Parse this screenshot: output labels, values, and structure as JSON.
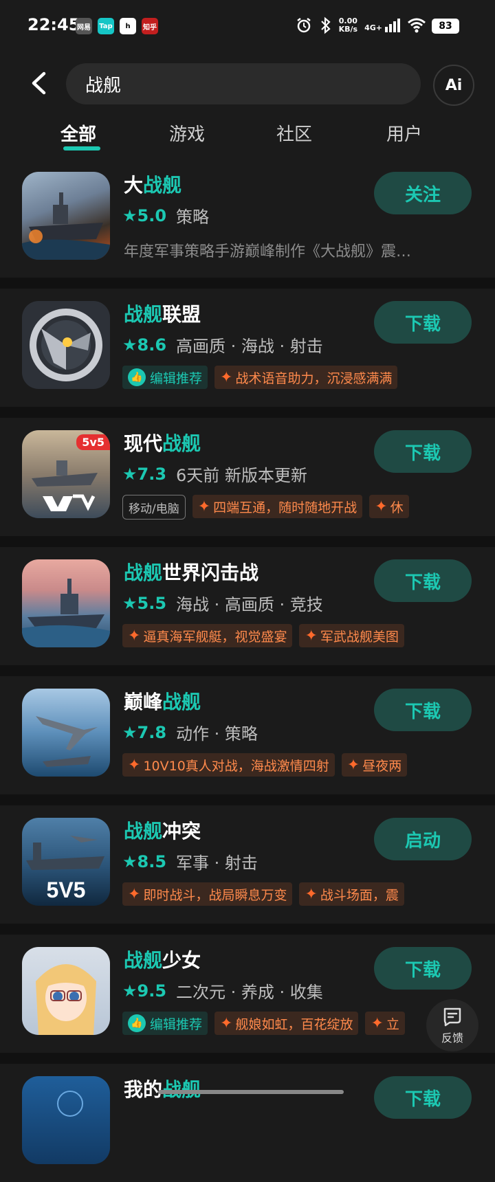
{
  "status": {
    "time": "22:45",
    "app_icons": [
      "网易",
      "Tap",
      "h",
      "知乎"
    ],
    "net_speed_value": "0.00",
    "net_speed_unit": "KB/s",
    "network": "4G+",
    "battery": "83"
  },
  "search": {
    "query": "战舰",
    "ai_label": "Ai"
  },
  "tabs": [
    {
      "label": "全部",
      "active": true
    },
    {
      "label": "游戏",
      "active": false
    },
    {
      "label": "社区",
      "active": false
    },
    {
      "label": "用户",
      "active": false
    }
  ],
  "results": [
    {
      "title_prefix": "大",
      "title_hl": "战舰",
      "title_suffix": "",
      "rating": "★5.0",
      "meta": "策略",
      "desc": "年度军事策略手游巅峰制作《大战舰》震…",
      "action": "关注",
      "tags": []
    },
    {
      "title_prefix": "",
      "title_hl": "战舰",
      "title_suffix": "联盟",
      "rating": "★8.6",
      "meta": "高画质 · 海战 · 射击",
      "desc": "",
      "action": "下载",
      "tags": [
        "编辑推荐",
        "战术语音助力，沉浸感满满"
      ]
    },
    {
      "title_prefix": "现代",
      "title_hl": "战舰",
      "title_suffix": "",
      "rating": "★7.3",
      "meta": "6天前 新版本更新",
      "desc": "",
      "action": "下载",
      "badge": "5v5",
      "platform": "移动/电脑",
      "tags": [
        "四端互通，随时随地开战",
        "休"
      ]
    },
    {
      "title_prefix": "",
      "title_hl": "战舰",
      "title_suffix": "世界闪击战",
      "rating": "★5.5",
      "meta": "海战 · 高画质 · 竞技",
      "desc": "",
      "action": "下载",
      "tags": [
        "逼真海军舰艇，视觉盛宴",
        "军武战舰美图"
      ]
    },
    {
      "title_prefix": "巅峰",
      "title_hl": "战舰",
      "title_suffix": "",
      "rating": "★7.8",
      "meta": "动作 · 策略",
      "desc": "",
      "action": "下载",
      "tags": [
        "10V10真人对战，海战激情四射",
        "昼夜两"
      ]
    },
    {
      "title_prefix": "",
      "title_hl": "战舰",
      "title_suffix": "冲突",
      "rating": "★8.5",
      "meta": "军事 · 射击",
      "desc": "",
      "action": "启动",
      "tags": [
        "即时战斗，战局瞬息万变",
        "战斗场面，震"
      ]
    },
    {
      "title_prefix": "",
      "title_hl": "战舰",
      "title_suffix": "少女",
      "rating": "★9.5",
      "meta": "二次元 · 养成 · 收集",
      "desc": "",
      "action": "下载",
      "tags": [
        "编辑推荐",
        "舰娘如虹，百花绽放",
        "立"
      ]
    },
    {
      "title_prefix": "我的",
      "title_hl": "战舰",
      "title_suffix": "",
      "rating": "",
      "meta": "",
      "desc": "",
      "action": "下载",
      "tags": []
    }
  ],
  "feedback_label": "反馈",
  "colors": {
    "accent": "#1cc8b2",
    "tag_orange": "#ff8a4c",
    "bg": "#1b1b1b"
  }
}
